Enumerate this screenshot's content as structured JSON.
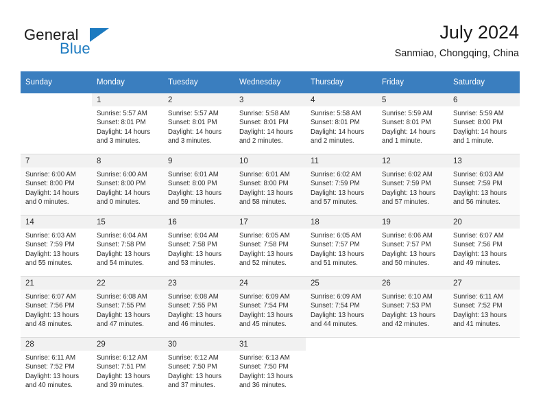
{
  "brand": {
    "name_part1": "General",
    "name_part2": "Blue",
    "accent_color": "#1c7ac0",
    "triangle_icon": "triangle-icon"
  },
  "header": {
    "title": "July 2024",
    "subtitle": "Sanmiao, Chongqing, China"
  },
  "theme": {
    "header_row_bg": "#3a7ebf",
    "header_row_text": "#ffffff",
    "daynum_bg": "#f1f1f1",
    "alt_row_bg": "#fafafa",
    "text_color": "#2b2b2b"
  },
  "weekdays": [
    "Sunday",
    "Monday",
    "Tuesday",
    "Wednesday",
    "Thursday",
    "Friday",
    "Saturday"
  ],
  "weeks": [
    [
      {
        "day": "",
        "lines": []
      },
      {
        "day": "1",
        "lines": [
          "Sunrise: 5:57 AM",
          "Sunset: 8:01 PM",
          "Daylight: 14 hours",
          "and 3 minutes."
        ]
      },
      {
        "day": "2",
        "lines": [
          "Sunrise: 5:57 AM",
          "Sunset: 8:01 PM",
          "Daylight: 14 hours",
          "and 3 minutes."
        ]
      },
      {
        "day": "3",
        "lines": [
          "Sunrise: 5:58 AM",
          "Sunset: 8:01 PM",
          "Daylight: 14 hours",
          "and 2 minutes."
        ]
      },
      {
        "day": "4",
        "lines": [
          "Sunrise: 5:58 AM",
          "Sunset: 8:01 PM",
          "Daylight: 14 hours",
          "and 2 minutes."
        ]
      },
      {
        "day": "5",
        "lines": [
          "Sunrise: 5:59 AM",
          "Sunset: 8:01 PM",
          "Daylight: 14 hours",
          "and 1 minute."
        ]
      },
      {
        "day": "6",
        "lines": [
          "Sunrise: 5:59 AM",
          "Sunset: 8:00 PM",
          "Daylight: 14 hours",
          "and 1 minute."
        ]
      }
    ],
    [
      {
        "day": "7",
        "lines": [
          "Sunrise: 6:00 AM",
          "Sunset: 8:00 PM",
          "Daylight: 14 hours",
          "and 0 minutes."
        ]
      },
      {
        "day": "8",
        "lines": [
          "Sunrise: 6:00 AM",
          "Sunset: 8:00 PM",
          "Daylight: 14 hours",
          "and 0 minutes."
        ]
      },
      {
        "day": "9",
        "lines": [
          "Sunrise: 6:01 AM",
          "Sunset: 8:00 PM",
          "Daylight: 13 hours",
          "and 59 minutes."
        ]
      },
      {
        "day": "10",
        "lines": [
          "Sunrise: 6:01 AM",
          "Sunset: 8:00 PM",
          "Daylight: 13 hours",
          "and 58 minutes."
        ]
      },
      {
        "day": "11",
        "lines": [
          "Sunrise: 6:02 AM",
          "Sunset: 7:59 PM",
          "Daylight: 13 hours",
          "and 57 minutes."
        ]
      },
      {
        "day": "12",
        "lines": [
          "Sunrise: 6:02 AM",
          "Sunset: 7:59 PM",
          "Daylight: 13 hours",
          "and 57 minutes."
        ]
      },
      {
        "day": "13",
        "lines": [
          "Sunrise: 6:03 AM",
          "Sunset: 7:59 PM",
          "Daylight: 13 hours",
          "and 56 minutes."
        ]
      }
    ],
    [
      {
        "day": "14",
        "lines": [
          "Sunrise: 6:03 AM",
          "Sunset: 7:59 PM",
          "Daylight: 13 hours",
          "and 55 minutes."
        ]
      },
      {
        "day": "15",
        "lines": [
          "Sunrise: 6:04 AM",
          "Sunset: 7:58 PM",
          "Daylight: 13 hours",
          "and 54 minutes."
        ]
      },
      {
        "day": "16",
        "lines": [
          "Sunrise: 6:04 AM",
          "Sunset: 7:58 PM",
          "Daylight: 13 hours",
          "and 53 minutes."
        ]
      },
      {
        "day": "17",
        "lines": [
          "Sunrise: 6:05 AM",
          "Sunset: 7:58 PM",
          "Daylight: 13 hours",
          "and 52 minutes."
        ]
      },
      {
        "day": "18",
        "lines": [
          "Sunrise: 6:05 AM",
          "Sunset: 7:57 PM",
          "Daylight: 13 hours",
          "and 51 minutes."
        ]
      },
      {
        "day": "19",
        "lines": [
          "Sunrise: 6:06 AM",
          "Sunset: 7:57 PM",
          "Daylight: 13 hours",
          "and 50 minutes."
        ]
      },
      {
        "day": "20",
        "lines": [
          "Sunrise: 6:07 AM",
          "Sunset: 7:56 PM",
          "Daylight: 13 hours",
          "and 49 minutes."
        ]
      }
    ],
    [
      {
        "day": "21",
        "lines": [
          "Sunrise: 6:07 AM",
          "Sunset: 7:56 PM",
          "Daylight: 13 hours",
          "and 48 minutes."
        ]
      },
      {
        "day": "22",
        "lines": [
          "Sunrise: 6:08 AM",
          "Sunset: 7:55 PM",
          "Daylight: 13 hours",
          "and 47 minutes."
        ]
      },
      {
        "day": "23",
        "lines": [
          "Sunrise: 6:08 AM",
          "Sunset: 7:55 PM",
          "Daylight: 13 hours",
          "and 46 minutes."
        ]
      },
      {
        "day": "24",
        "lines": [
          "Sunrise: 6:09 AM",
          "Sunset: 7:54 PM",
          "Daylight: 13 hours",
          "and 45 minutes."
        ]
      },
      {
        "day": "25",
        "lines": [
          "Sunrise: 6:09 AM",
          "Sunset: 7:54 PM",
          "Daylight: 13 hours",
          "and 44 minutes."
        ]
      },
      {
        "day": "26",
        "lines": [
          "Sunrise: 6:10 AM",
          "Sunset: 7:53 PM",
          "Daylight: 13 hours",
          "and 42 minutes."
        ]
      },
      {
        "day": "27",
        "lines": [
          "Sunrise: 6:11 AM",
          "Sunset: 7:52 PM",
          "Daylight: 13 hours",
          "and 41 minutes."
        ]
      }
    ],
    [
      {
        "day": "28",
        "lines": [
          "Sunrise: 6:11 AM",
          "Sunset: 7:52 PM",
          "Daylight: 13 hours",
          "and 40 minutes."
        ]
      },
      {
        "day": "29",
        "lines": [
          "Sunrise: 6:12 AM",
          "Sunset: 7:51 PM",
          "Daylight: 13 hours",
          "and 39 minutes."
        ]
      },
      {
        "day": "30",
        "lines": [
          "Sunrise: 6:12 AM",
          "Sunset: 7:50 PM",
          "Daylight: 13 hours",
          "and 37 minutes."
        ]
      },
      {
        "day": "31",
        "lines": [
          "Sunrise: 6:13 AM",
          "Sunset: 7:50 PM",
          "Daylight: 13 hours",
          "and 36 minutes."
        ]
      },
      {
        "day": "",
        "lines": []
      },
      {
        "day": "",
        "lines": []
      },
      {
        "day": "",
        "lines": []
      }
    ]
  ]
}
